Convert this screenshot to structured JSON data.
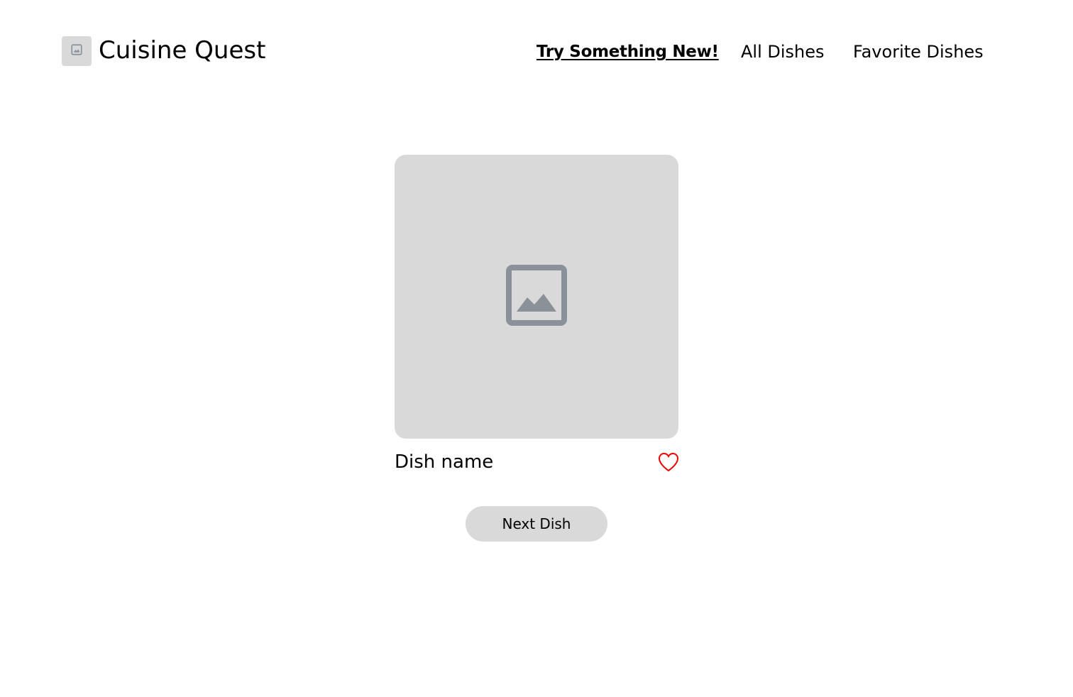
{
  "header": {
    "logo_icon": "image-placeholder-icon",
    "title": "Cuisine Quest"
  },
  "nav": {
    "items": [
      {
        "label": "Try Something New!",
        "active": true
      },
      {
        "label": "All Dishes",
        "active": false
      },
      {
        "label": "Favorite Dishes",
        "active": false
      }
    ]
  },
  "card": {
    "image_icon": "image-placeholder-icon",
    "dish_name": "Dish name",
    "favorite_icon": "heart-outline-icon",
    "favorite_color": "#e60000"
  },
  "actions": {
    "next_label": "Next Dish"
  },
  "colors": {
    "placeholder_bg": "#d9d9d9",
    "placeholder_icon": "#8a9199"
  }
}
